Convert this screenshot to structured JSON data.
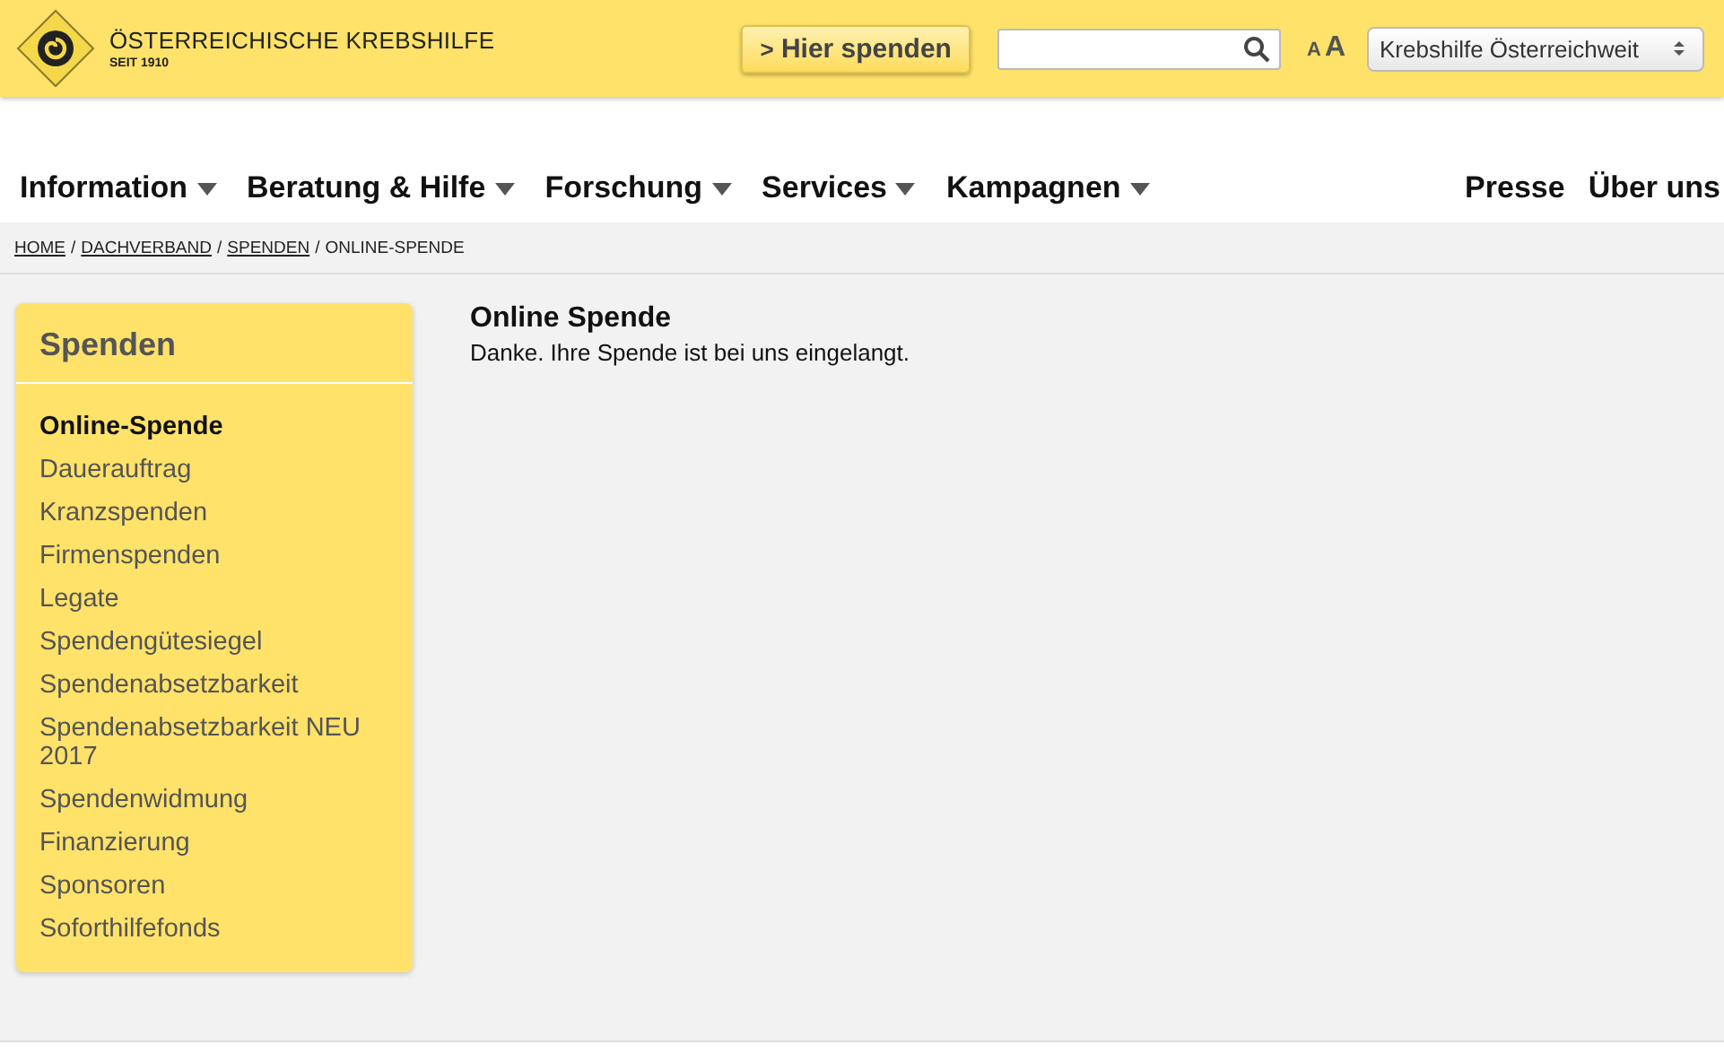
{
  "header": {
    "logo_name": "ÖSTERREICHISCHE KREBSHILFE",
    "logo_tagline": "SEIT 1910",
    "donate_button": {
      "icon": ">",
      "label": "Hier spenden"
    },
    "text_size": [
      "A",
      "A"
    ],
    "region_select": "Krebshilfe Österreichweit"
  },
  "nav": {
    "menus": [
      {
        "label": "Information",
        "dropdown": true
      },
      {
        "label": "Beratung & Hilfe",
        "dropdown": true
      },
      {
        "label": "Forschung",
        "dropdown": true
      },
      {
        "label": "Services",
        "dropdown": true
      },
      {
        "label": "Kampagnen",
        "dropdown": true
      }
    ],
    "links": [
      "Presse",
      "Über uns"
    ]
  },
  "breadcrumb": {
    "separator": "/",
    "items": [
      {
        "label": "HOME",
        "link": true
      },
      {
        "label": "DACHVERBAND",
        "link": true
      },
      {
        "label": "SPENDEN",
        "link": true
      },
      {
        "label": "ONLINE-SPENDE",
        "link": false
      }
    ]
  },
  "sidebar": {
    "title": "Spenden",
    "items": [
      {
        "label": "Online-Spende",
        "selected": true
      },
      {
        "label": "Dauerauftrag",
        "selected": false
      },
      {
        "label": "Kranzspenden",
        "selected": false
      },
      {
        "label": "Firmenspenden",
        "selected": false
      },
      {
        "label": "Legate",
        "selected": false
      },
      {
        "label": "Spendengütesiegel",
        "selected": false
      },
      {
        "label": "Spendenabsetzbarkeit",
        "selected": false
      },
      {
        "label": "Spendenabsetzbarkeit NEU 2017",
        "selected": false
      },
      {
        "label": "Spendenwidmung",
        "selected": false
      },
      {
        "label": "Finanzierung",
        "selected": false
      },
      {
        "label": "Sponsoren",
        "selected": false
      },
      {
        "label": "Soforthilfefonds",
        "selected": false
      }
    ]
  },
  "content": {
    "title": "Online Spende",
    "text": "Danke. Ihre Spende ist bei uns eingelangt."
  }
}
